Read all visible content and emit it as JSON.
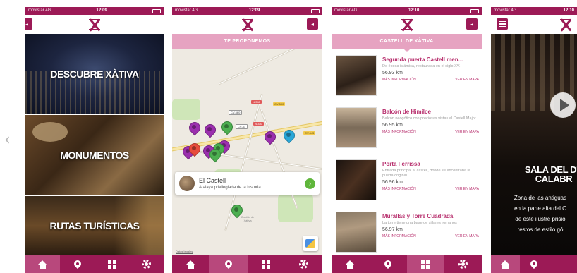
{
  "status": {
    "carrier": "movistar 4G",
    "times": [
      "12:09",
      "12:09",
      "12:10",
      "12:10"
    ]
  },
  "phone1": {
    "tiles": [
      {
        "label": "DESCUBRE XÀTIVA"
      },
      {
        "label": "MONUMENTOS"
      },
      {
        "label": "RUTAS TURÍSTICAS"
      }
    ]
  },
  "phone2": {
    "banner": "TE PROPONEMOS",
    "road_labels": [
      "CV-560",
      "N-340",
      "CV-590",
      "N-340",
      "CV-41",
      "CV-645"
    ],
    "info_card": {
      "title": "El Castell",
      "subtitle": "Atalaya privilegiada de la historia"
    },
    "map_place": "Castillo de Xàtiva",
    "legal": "Datos legales",
    "markers": [
      {
        "color": "#9b2fae"
      },
      {
        "color": "#9b2fae"
      },
      {
        "color": "#4caf50"
      },
      {
        "color": "#9b2fae"
      },
      {
        "color": "#e74c3c"
      },
      {
        "color": "#9b2fae"
      },
      {
        "color": "#4caf50"
      },
      {
        "color": "#9b2fae"
      },
      {
        "color": "#9b2fae"
      },
      {
        "color": "#4caf50"
      },
      {
        "color": "#2aa7d8"
      },
      {
        "color": "#4caf50"
      }
    ]
  },
  "phone3": {
    "banner": "CASTELL DE XÀTIVA",
    "more_info": "MÁS INFORMACIÓN",
    "view_on_map": "VER EN MAPA",
    "items": [
      {
        "title": "Segunda puerta Castell men...",
        "description": "De época islámica, restaurada en el siglo XV.",
        "distance": "56.93 km"
      },
      {
        "title": "Balcón de Himilce",
        "description": "Balcón neogótico con preciosas vistas al Castell Major",
        "distance": "56.95 km"
      },
      {
        "title": "Porta Ferrissa",
        "description": "Entrada principal al castell, donde se encontraba la puerta original.",
        "distance": "56.96 km"
      },
      {
        "title": "Murallas y Torre Cuadrada",
        "description": "La torre tiene una base de sillares romanos",
        "distance": "56.97 km"
      }
    ]
  },
  "phone4": {
    "video_title_line1": "SALA DEL DU",
    "video_title_line2": "CALABR",
    "video_text": [
      "Zona de las antiguas",
      "en la parte alta del C",
      "de este ilustre prisio",
      "restos de estilo gó"
    ]
  },
  "colors": {
    "primary": "#9c1a56",
    "banner": "#e6a3c1",
    "tab_active": "#b8487c"
  },
  "icons": {
    "tabs": [
      "home-icon",
      "map-pin-icon",
      "grid-icon",
      "gear-icon"
    ],
    "carousel_prev": "‹"
  }
}
